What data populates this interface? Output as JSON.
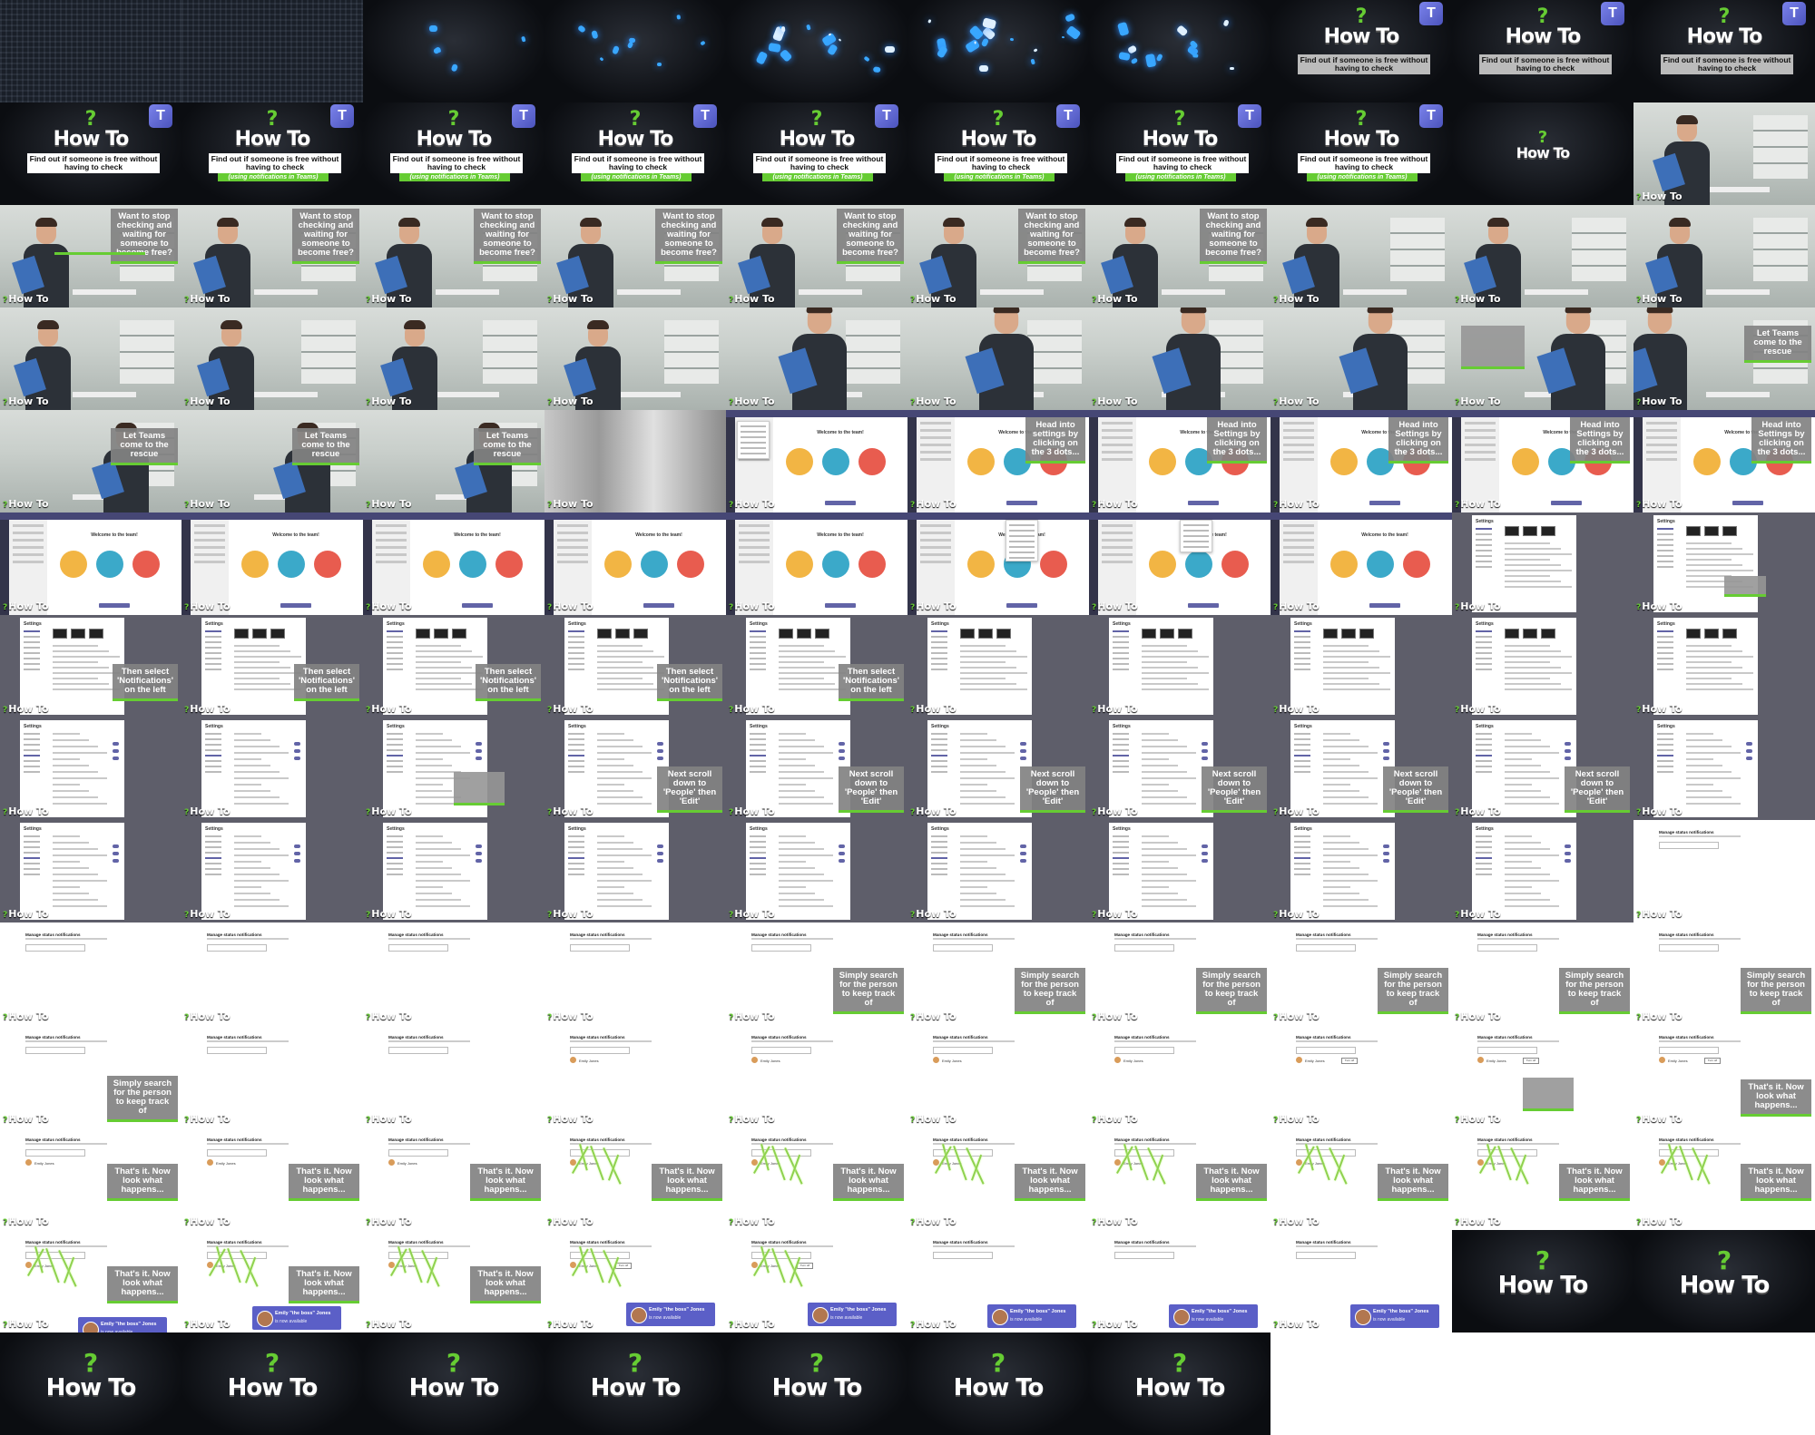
{
  "brand": {
    "logo_text": "How To",
    "logo_mark": "?",
    "teams_letter": "T",
    "accent": "#66cc33",
    "teams_purple": "#6264a7"
  },
  "titles": {
    "main": "Find out if someone is free without having to check",
    "sub": "(using notifications in Teams)"
  },
  "captions": {
    "stop_waiting": "Want to stop checking and waiting for someone to become free?",
    "let_teams": "Let Teams come to the rescue",
    "head_into": "Head into settings by clicking on the 3 dots...",
    "head_into_alt": "Head into Settings by clicking on the 3 dots...",
    "then_select": "Then select 'Notifications' on the left",
    "next_scroll": "Next scroll down to 'People' then 'Edit'",
    "simply_search": "Simply search for the person to keep track of",
    "thats_it": "That's it. Now look what happens..."
  },
  "teams_ui": {
    "welcome": "Welcome to the team!",
    "settings_title": "Settings",
    "notif_title": "Manage status notifications",
    "contact_name": "Emily Jones",
    "turn_off": "Turn off"
  },
  "toast": {
    "name": "Emily \"the boss\" Jones",
    "status": "is now available"
  },
  "grid": {
    "columns": 10,
    "rows": 14
  }
}
